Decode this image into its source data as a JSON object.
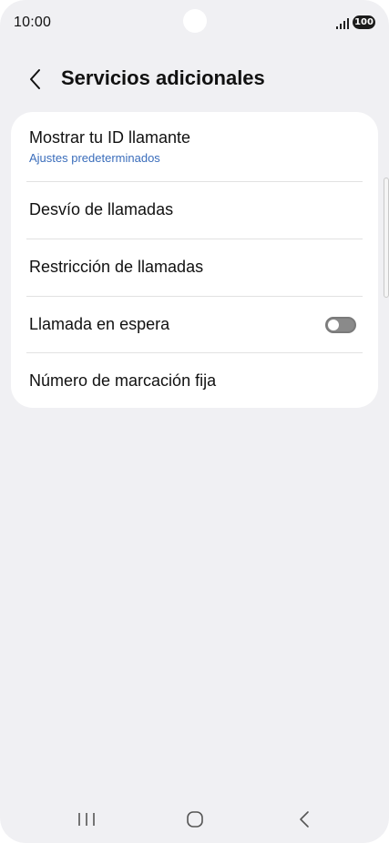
{
  "status_bar": {
    "time": "10:00",
    "battery": "100"
  },
  "header": {
    "title": "Servicios adicionales"
  },
  "settings": {
    "caller_id": {
      "label": "Mostrar tu ID llamante",
      "value": "Ajustes predeterminados"
    },
    "call_forwarding": {
      "label": "Desvío de llamadas"
    },
    "call_barring": {
      "label": "Restricción de llamadas"
    },
    "call_waiting": {
      "label": "Llamada en espera",
      "enabled": false
    },
    "fixed_dialing": {
      "label": "Número de marcación fija"
    }
  },
  "colors": {
    "background": "#f0f0f3",
    "card": "#ffffff",
    "accent_link": "#3a6dbb",
    "toggle_off": "#8a8a8a"
  },
  "icons": {
    "back": "chevron-left-icon",
    "signal": "signal-bars-icon",
    "nav_recents": "recents-icon",
    "nav_home": "home-icon",
    "nav_back": "back-icon"
  }
}
